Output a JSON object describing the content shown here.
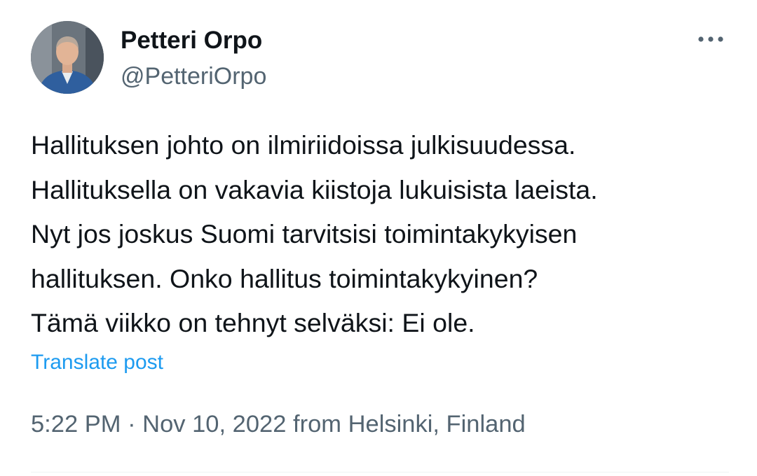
{
  "author": {
    "name": "Petteri Orpo",
    "handle": "@PetteriOrpo"
  },
  "tweet": {
    "lines": [
      "Hallituksen johto on ilmiriidoissa julkisuudessa.",
      "Hallituksella on vakavia kiistoja lukuisista laeista.",
      "Nyt jos joskus Suomi tarvitsisi toimintakykyisen",
      "hallituksen. Onko hallitus toimintakykyinen?",
      "Tämä viikko on tehnyt selväksi: Ei ole."
    ],
    "translate_label": "Translate post"
  },
  "meta": {
    "time": "5:22 PM",
    "separator": "·",
    "date": "Nov 10, 2022",
    "location_prefix": "from",
    "location": "Helsinki, Finland"
  },
  "icons": {
    "more": "more-horizontal-icon"
  },
  "colors": {
    "text_primary": "#0f1419",
    "text_secondary": "#536471",
    "link": "#1d9bf0",
    "divider": "#eff3f4"
  }
}
